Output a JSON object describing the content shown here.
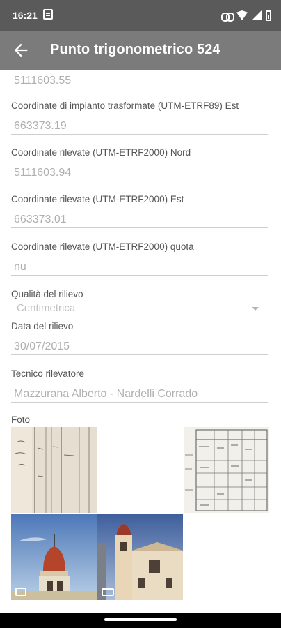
{
  "status": {
    "time": "16:21"
  },
  "app_bar": {
    "title": "Punto trigonometrico 524"
  },
  "fields": {
    "nord_trasformate": {
      "value": "5111603.55"
    },
    "est_trasformate": {
      "label": "Coordinate di impianto trasformate (UTM-ETRF89) Est",
      "value": "663373.19"
    },
    "nord_rilevate": {
      "label": "Coordinate rilevate (UTM-ETRF2000) Nord",
      "value": "5111603.94"
    },
    "est_rilevate": {
      "label": "Coordinate rilevate (UTM-ETRF2000) Est",
      "value": "663373.01"
    },
    "quota_rilevate": {
      "label": "Coordinate rilevate (UTM-ETRF2000) quota",
      "value": "nu"
    },
    "qualita": {
      "label": "Qualità del rilievo",
      "value": "Centimetrica"
    },
    "data": {
      "label": "Data del rilievo",
      "value": "30/07/2015"
    },
    "tecnico": {
      "label": "Tecnico rilevatore",
      "value": "Mazzurana Alberto - Nardelli Corrado"
    }
  },
  "photos": {
    "label": "Foto",
    "items": [
      {
        "name": "handwritten-register-page"
      },
      {
        "name": "blank-photo"
      },
      {
        "name": "survey-table-document"
      },
      {
        "name": "bell-tower-dome",
        "badge": "image-icon"
      },
      {
        "name": "church-tower-building",
        "badge": "panorama-icon"
      }
    ]
  },
  "colors": {
    "status_bar": "#5a5a5a",
    "app_bar": "#7b7b7b",
    "label_text": "#555555",
    "value_text": "#b0b0b0",
    "underline": "#cfcfcf"
  }
}
